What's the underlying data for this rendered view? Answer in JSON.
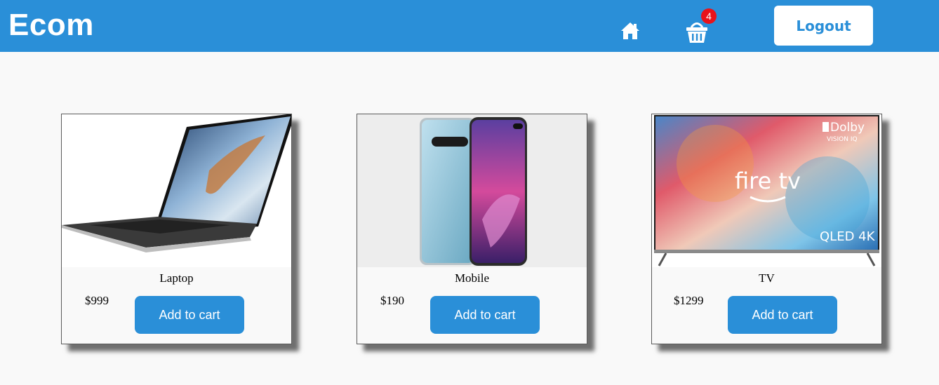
{
  "header": {
    "brand": "Ecom",
    "home_icon": "home-icon",
    "cart_icon": "basket-icon",
    "cart_count": "4",
    "logout_label": "Logout"
  },
  "colors": {
    "primary": "#2a8fd8",
    "badge": "#e8131a",
    "background": "#f9f9f9"
  },
  "products": [
    {
      "name": "Laptop",
      "price": "$999",
      "button_label": "Add to cart",
      "image": "laptop-image"
    },
    {
      "name": "Mobile",
      "price": "$190",
      "button_label": "Add to cart",
      "image": "smartphone-image"
    },
    {
      "name": "TV",
      "price": "$1299",
      "button_label": "Add to cart",
      "image": "television-image",
      "image_text": {
        "brand": "Dolby",
        "sub": "VISION IQ",
        "logo": "fire tv",
        "badge": "QLED 4K"
      }
    }
  ]
}
